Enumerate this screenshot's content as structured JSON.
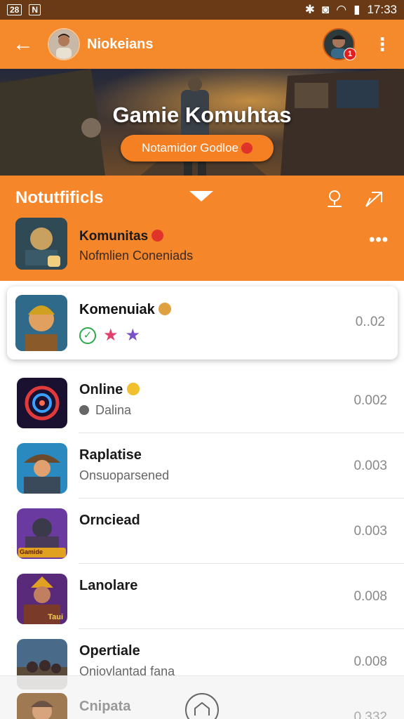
{
  "status": {
    "left_box1": "28",
    "left_box2": "N",
    "time": "17:33"
  },
  "header": {
    "username": "Niokeians",
    "badge_count": "1"
  },
  "banner": {
    "title": "Gamie Komuhtas",
    "pill_text": "Notamidor Godloe"
  },
  "notifications": {
    "title": "Notutfificls",
    "community_name": "Komunitas",
    "community_subtitle": "Nofmlien Coneniads"
  },
  "featured": {
    "name": "Komenuiak",
    "value": "0..02"
  },
  "list": [
    {
      "name": "Online",
      "sub": "Dalina",
      "value": "0.002"
    },
    {
      "name": "Raplatise",
      "sub": "Onsuoparsened",
      "value": "0.003"
    },
    {
      "name": "Ornciead",
      "sub": "",
      "value": "0.003",
      "thumb_text": "Gamide"
    },
    {
      "name": "Lanolare",
      "sub": "",
      "value": "0.008",
      "thumb_text": "Taui"
    },
    {
      "name": "Opertiale",
      "sub": "Oniovlantad fana",
      "value": "0.008"
    }
  ],
  "bottom": {
    "name": "Cnipata",
    "value": "0.332"
  },
  "colors": {
    "accent": "#f58a2d",
    "status_bar": "#6a3a16"
  }
}
